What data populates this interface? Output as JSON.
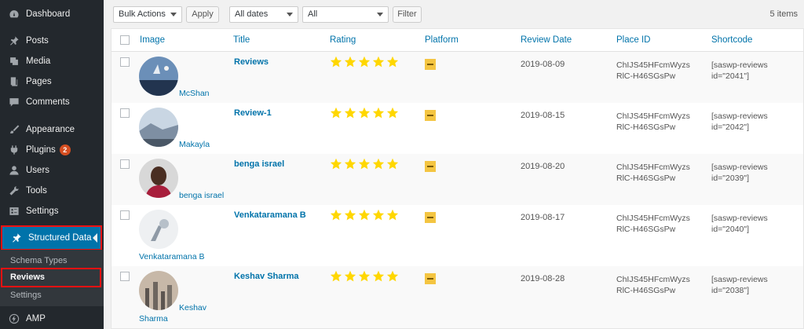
{
  "sidebar": {
    "items": [
      {
        "label": "Dashboard",
        "icon": "dashboard-icon"
      },
      {
        "label": "Posts",
        "icon": "pushpin-icon"
      },
      {
        "label": "Media",
        "icon": "media-icon"
      },
      {
        "label": "Pages",
        "icon": "pages-icon"
      },
      {
        "label": "Comments",
        "icon": "comments-icon"
      },
      {
        "label": "Appearance",
        "icon": "paintbrush-icon"
      },
      {
        "label": "Plugins",
        "icon": "plugins-icon",
        "badge": "2"
      },
      {
        "label": "Users",
        "icon": "users-icon"
      },
      {
        "label": "Tools",
        "icon": "wrench-icon"
      },
      {
        "label": "Settings",
        "icon": "settings-icon"
      }
    ],
    "active": {
      "label": "Structured Data",
      "icon": "pushpin-icon"
    },
    "submenu": [
      "Schema Types",
      "Reviews",
      "Settings"
    ],
    "amp": {
      "label": "AMP",
      "icon": "amp-icon"
    }
  },
  "toolbar": {
    "bulk_actions": "Bulk Actions",
    "apply": "Apply",
    "dates": "All dates",
    "all": "All",
    "filter": "Filter",
    "items_count": "5 items"
  },
  "table": {
    "columns": [
      "Image",
      "Title",
      "Rating",
      "Platform",
      "Review Date",
      "Place ID",
      "Shortcode"
    ],
    "rows": [
      {
        "author": "McShan",
        "title": "Reviews",
        "rating": 5,
        "date": "2019-08-09",
        "place_id": "ChIJS45HFcmWyzsRlC-H46SGsPw",
        "shortcode": "[saswp-reviews id=\"2041\"]"
      },
      {
        "author": "Makayla",
        "title": "Review-1",
        "rating": 5,
        "date": "2019-08-15",
        "place_id": "ChIJS45HFcmWyzsRlC-H46SGsPw",
        "shortcode": "[saswp-reviews id=\"2042\"]"
      },
      {
        "author": "benga israel",
        "title": "benga israel",
        "rating": 5,
        "date": "2019-08-20",
        "place_id": "ChIJS45HFcmWyzsRlC-H46SGsPw",
        "shortcode": "[saswp-reviews id=\"2039\"]"
      },
      {
        "author": "Venkataramana B",
        "title": "Venkataramana B",
        "rating": 5,
        "date": "2019-08-17",
        "place_id": "ChIJS45HFcmWyzsRlC-H46SGsPw",
        "shortcode": "[saswp-reviews id=\"2040\"]"
      },
      {
        "author": "Keshav Sharma",
        "title": "Keshav Sharma",
        "rating": 5,
        "date": "2019-08-28",
        "place_id": "ChIJS45HFcmWyzsRlC-H46SGsPw",
        "shortcode": "[saswp-reviews id=\"2038\"]"
      }
    ]
  },
  "colors": {
    "sidebar": "#23282d",
    "active": "#0073aa",
    "link": "#0073aa",
    "star": "#ffd700",
    "highlight": "#e11111"
  }
}
